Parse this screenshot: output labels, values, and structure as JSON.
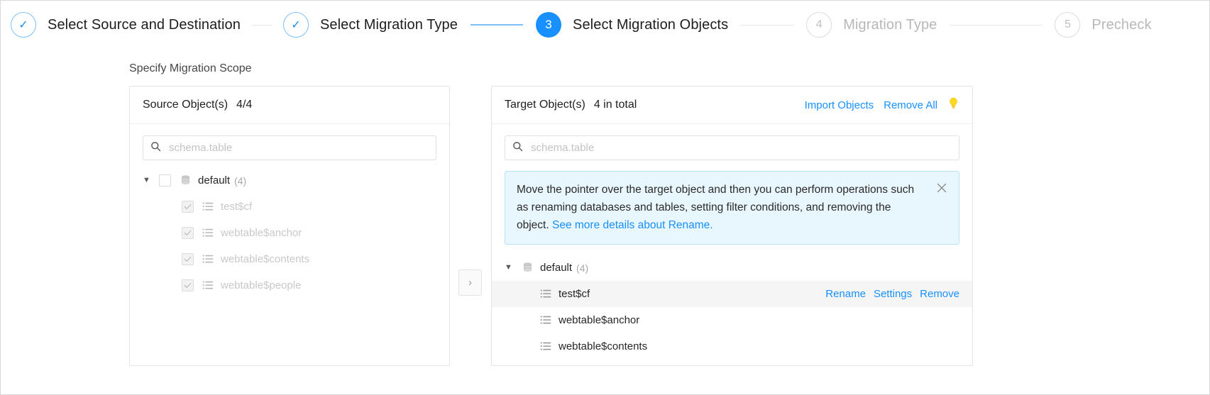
{
  "stepper": {
    "steps": [
      {
        "indicator": "✓",
        "label": "Select Source and Destination",
        "state": "done"
      },
      {
        "indicator": "✓",
        "label": "Select Migration Type",
        "state": "done"
      },
      {
        "indicator": "3",
        "label": "Select Migration Objects",
        "state": "current"
      },
      {
        "indicator": "4",
        "label": "Migration Type",
        "state": "todo"
      },
      {
        "indicator": "5",
        "label": "Precheck",
        "state": "todo"
      }
    ]
  },
  "section": {
    "title": "Specify Migration Scope"
  },
  "source_panel": {
    "title": "Source Object(s)",
    "count": "4/4",
    "search_placeholder": "schema.table",
    "search_value": "",
    "tree": {
      "root": {
        "name": "default",
        "sub": "(4)",
        "expanded": true,
        "checked": false
      },
      "children": [
        {
          "name": "test$cf",
          "checked": true,
          "disabled": true
        },
        {
          "name": "webtable$anchor",
          "checked": true,
          "disabled": true
        },
        {
          "name": "webtable$contents",
          "checked": true,
          "disabled": true
        },
        {
          "name": "webtable$people",
          "checked": true,
          "disabled": true
        }
      ]
    }
  },
  "target_panel": {
    "title": "Target Object(s)",
    "count": "4 in total",
    "actions": {
      "import": "Import Objects",
      "remove_all": "Remove All",
      "tip_icon": "lightbulb-icon"
    },
    "search_placeholder": "schema.table",
    "search_value": "",
    "banner": {
      "text_before_link": "Move the pointer over the target object and then you can perform operations such as renaming databases and tables, setting filter conditions, and removing the object. ",
      "link": "See more details about Rename.",
      "close_icon": "close-icon"
    },
    "tree": {
      "root": {
        "name": "default",
        "sub": "(4)",
        "expanded": true
      },
      "children": [
        {
          "name": "test$cf",
          "highlighted": true,
          "actions": [
            "Rename",
            "Settings",
            "Remove"
          ]
        },
        {
          "name": "webtable$anchor",
          "highlighted": false,
          "actions": []
        },
        {
          "name": "webtable$contents",
          "highlighted": false,
          "actions": []
        }
      ]
    }
  },
  "move_button": {
    "label": "›",
    "icon": "chevron-right-icon"
  },
  "colors": {
    "accent": "#1890ff",
    "step_done_border": "#7ec0f7",
    "muted_text": "#b8b8b8",
    "banner_bg": "#e8f6fd",
    "banner_border": "#b9e2f7",
    "row_highlight": "#f5f5f5",
    "bulb": "#f5d020"
  }
}
